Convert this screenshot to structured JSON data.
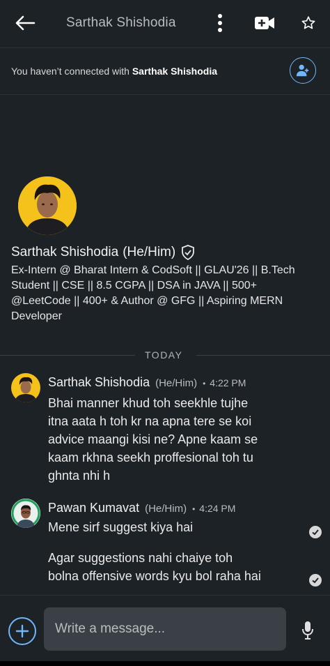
{
  "header": {
    "title": "Sarthak Shishodia",
    "icons": [
      "back-arrow-icon",
      "more-vertical-icon",
      "video-add-icon",
      "star-icon"
    ]
  },
  "banner": {
    "prefix": "You haven’t connected with ",
    "name": "Sarthak Shishodia"
  },
  "profile": {
    "name": "Sarthak Shishodia",
    "pronoun": "(He/Him)",
    "headline": "Ex-Intern @ Bharat Intern & CodSoft || GLAU'26 || B.Tech Student || CSE || 8.5 CGPA || DSA in JAVA || 500+ @LeetCode || 400+ & Author @ GFG || Aspiring MERN Developer"
  },
  "divider": {
    "label": "TODAY"
  },
  "messages": [
    {
      "sender": "Sarthak Shishodia",
      "pronoun": "(He/Him)",
      "dot": "•",
      "time": "4:22 PM",
      "lines": [
        "Bhai manner khud toh seekhle tujhe",
        "itna aata h toh kr na apna tere se koi",
        "advice maangi kisi ne? Apne kaam se",
        "kaam rkhna seekh proffesional toh tu",
        "ghnta nhi h"
      ]
    },
    {
      "sender": "Pawan Kumavat",
      "pronoun": "(He/Him)",
      "dot": "•",
      "time": "4:24 PM",
      "line1": "Mene sirf suggest kiya hai",
      "line2": "Agar suggestions nahi chaiye toh",
      "line3": "bolna offensive words kyu bol raha hai"
    }
  ],
  "composer": {
    "placeholder": "Write a message..."
  },
  "colors": {
    "background": "#1d2226",
    "accent": "#71b7fb",
    "avatar_yellow": "#f4c21b",
    "input_bg": "#3a4045"
  }
}
